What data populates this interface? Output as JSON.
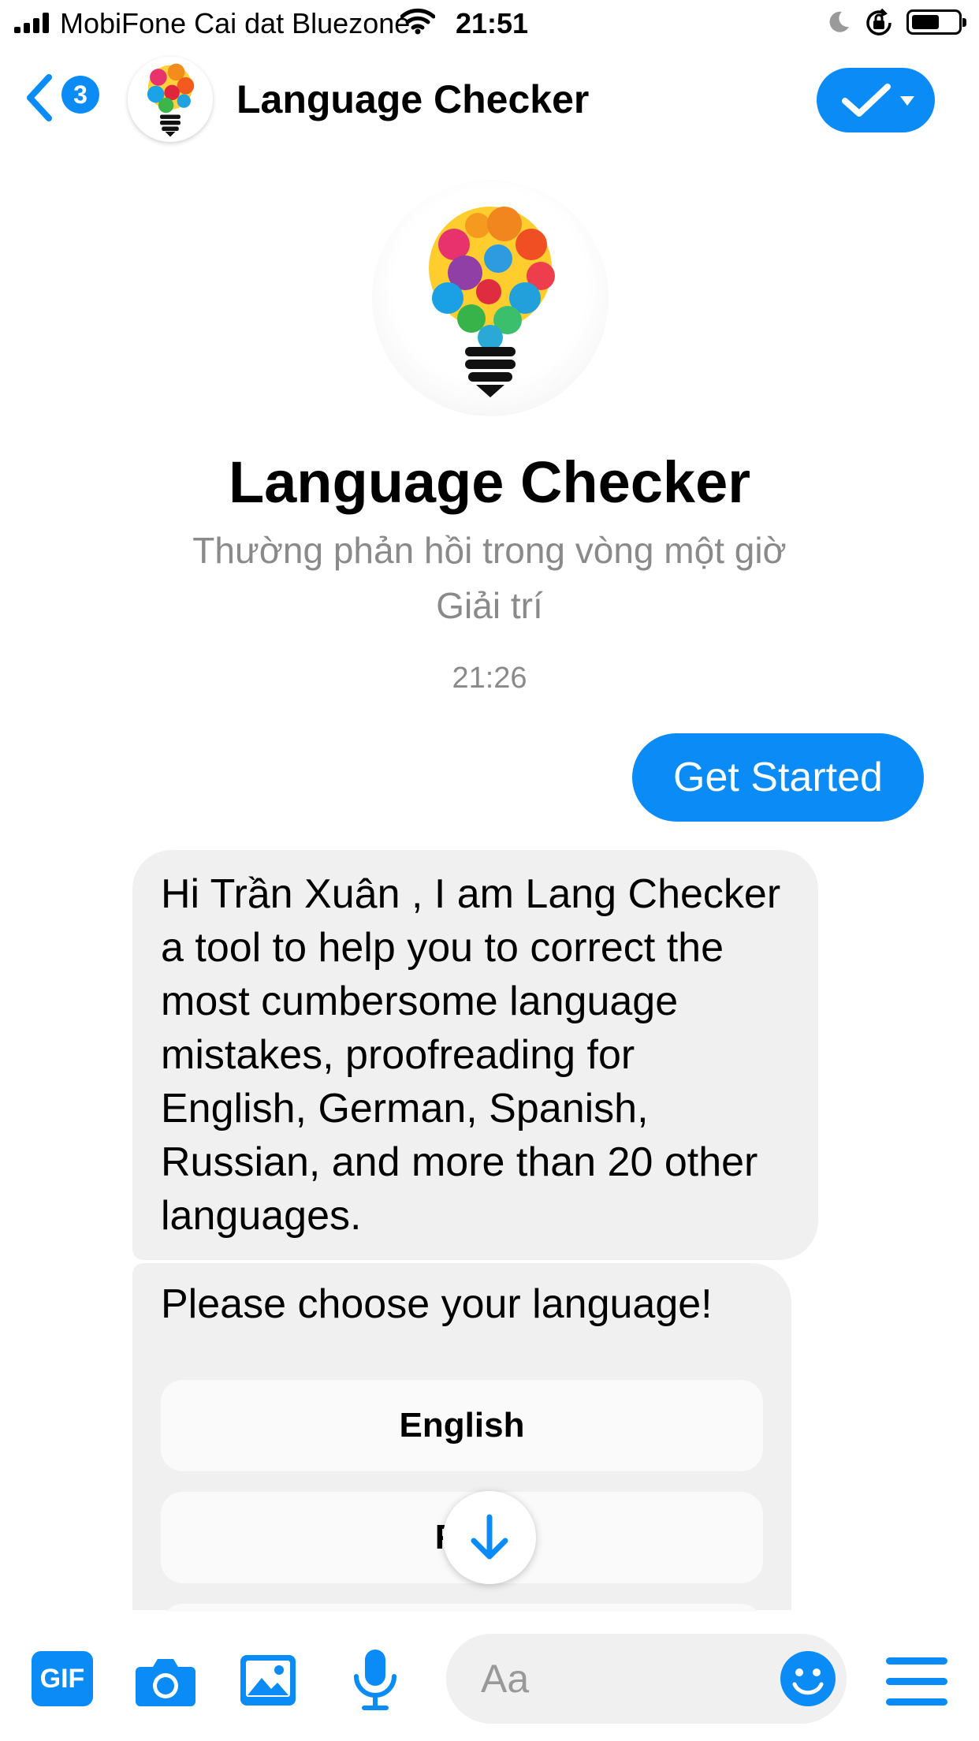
{
  "status_bar": {
    "carrier": "MobiFone Cai dat Bluezone",
    "time": "21:51",
    "battery_level": 0.6,
    "icons": [
      "signal-icon",
      "wifi-icon",
      "moon-icon",
      "rotation-lock-icon",
      "battery-icon"
    ]
  },
  "header": {
    "back_badge": "3",
    "title": "Language Checker",
    "icons": [
      "back-chevron-icon",
      "bot-avatar-icon",
      "checkmark-icon",
      "caret-down-icon"
    ]
  },
  "profile": {
    "name": "Language Checker",
    "response_time": "Thường phản hồi trong vòng một giờ",
    "category": "Giải trí"
  },
  "chat": {
    "timestamp": "21:26",
    "sent_message": "Get Started",
    "bot_message": "Hi Trần Xuân , I am Lang Checker a tool to help you to correct the most cumbersome language mistakes, proofreading for English, German, Spanish, Russian, and more than 20 other languages.",
    "prompt": "Please choose your language!",
    "quick_replies": [
      "English",
      "Fre"
    ]
  },
  "composer": {
    "gif_label": "GIF",
    "placeholder": "Aa",
    "icons": [
      "gif-icon",
      "camera-icon",
      "image-icon",
      "microphone-icon",
      "smiley-icon",
      "menu-icon"
    ]
  },
  "colors": {
    "accent": "#0a8bf5",
    "bubble": "#f0f0f0",
    "muted_text": "#8a8a8a"
  }
}
